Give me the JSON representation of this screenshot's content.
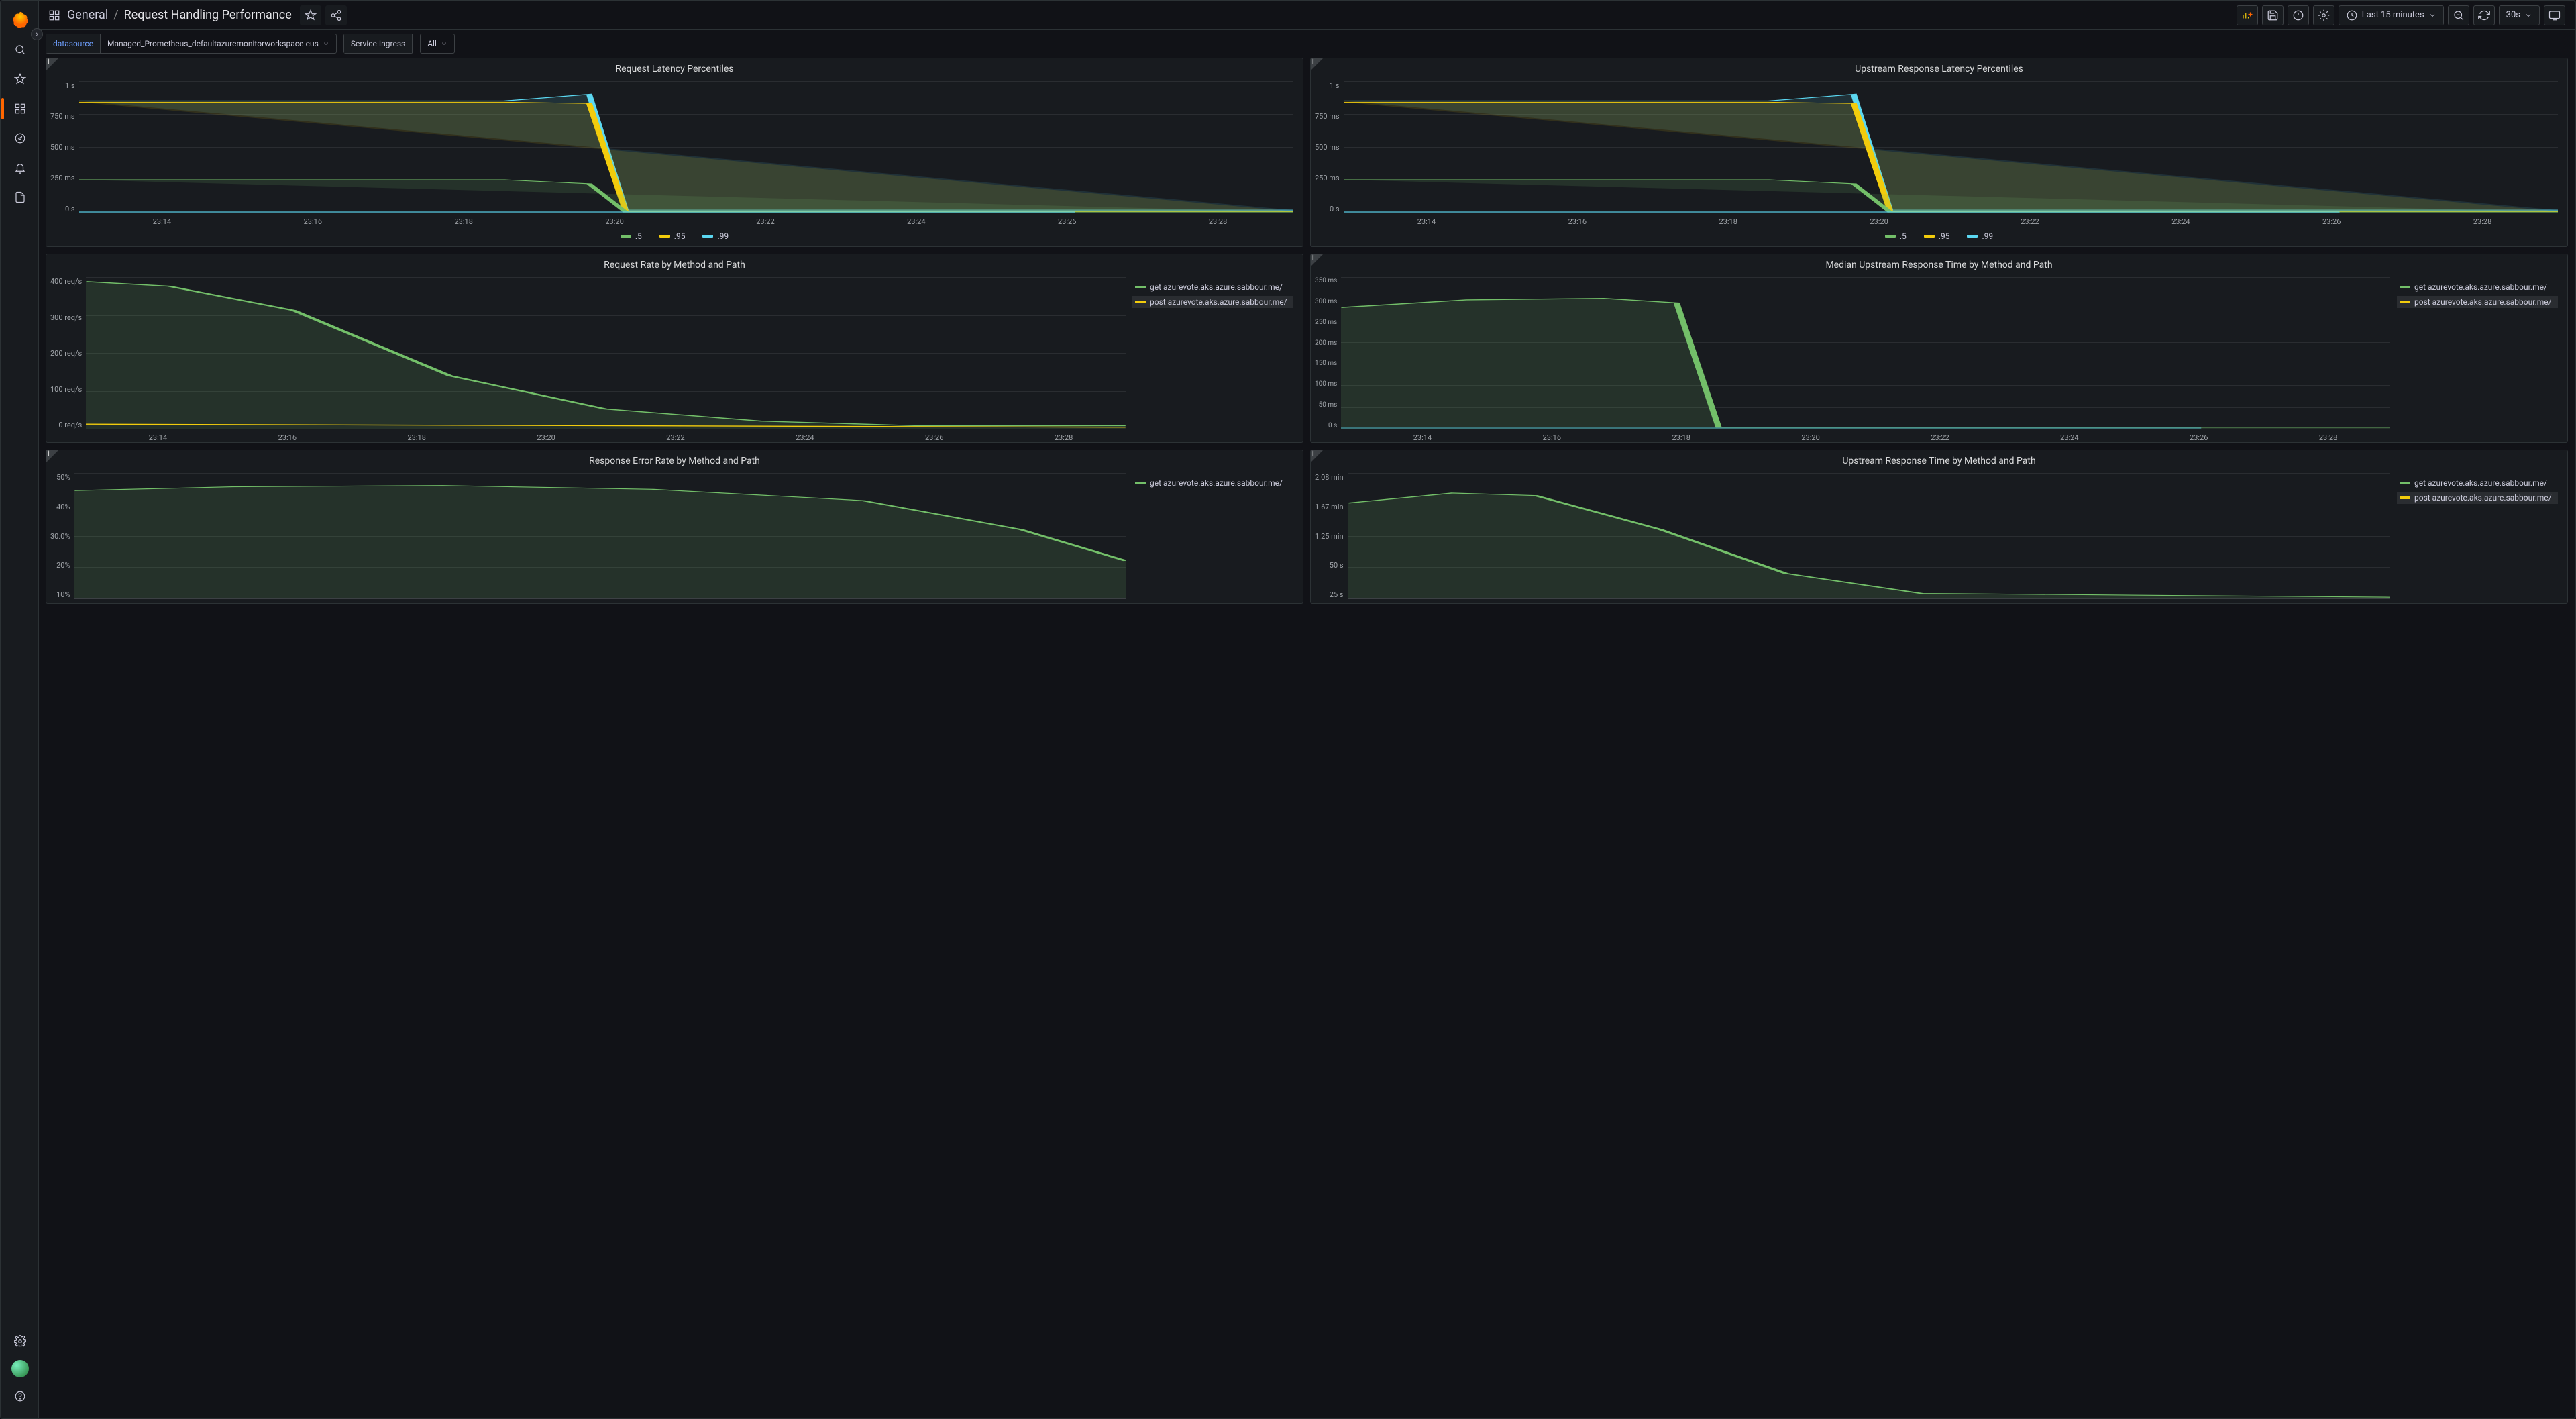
{
  "breadcrumb": {
    "folder": "General",
    "sep": "/",
    "title": "Request Handling Performance"
  },
  "toolbar": {
    "time_range": "Last 15 minutes",
    "refresh_interval": "30s"
  },
  "vars": {
    "datasource_label": "datasource",
    "datasource_value": "Managed_Prometheus_defaultazuremonitorworkspace-eus",
    "ingress_label": "Service Ingress",
    "ingress_value": "All"
  },
  "xticks": [
    "23:14",
    "23:16",
    "23:18",
    "23:20",
    "23:22",
    "23:24",
    "23:26",
    "23:28"
  ],
  "legend_percentile": [
    {
      "label": ".5",
      "cls": "sw-green"
    },
    {
      "label": ".95",
      "cls": "sw-yellow"
    },
    {
      "label": ".99",
      "cls": "sw-blue"
    }
  ],
  "legend_methods": [
    {
      "label": "get azurevote.aks.azure.sabbour.me/",
      "cls": "sw-green"
    },
    {
      "label": "post azurevote.aks.azure.sabbour.me/",
      "cls": "sw-yellow"
    }
  ],
  "legend_get_only": [
    {
      "label": "get azurevote.aks.azure.sabbour.me/",
      "cls": "sw-green"
    }
  ],
  "panels": {
    "p1": {
      "title": "Request Latency Percentiles",
      "yticks": [
        "1 s",
        "750 ms",
        "500 ms",
        "250 ms",
        "0 s"
      ]
    },
    "p2": {
      "title": "Upstream Response Latency Percentiles",
      "yticks": [
        "1 s",
        "750 ms",
        "500 ms",
        "250 ms",
        "0 s"
      ]
    },
    "p3": {
      "title": "Request Rate by Method and Path",
      "yticks": [
        "400 req/s",
        "300 req/s",
        "200 req/s",
        "100 req/s",
        "0 req/s"
      ]
    },
    "p4": {
      "title": "Median Upstream Response Time by Method and Path",
      "yticks": [
        "350 ms",
        "300 ms",
        "250 ms",
        "200 ms",
        "150 ms",
        "100 ms",
        "50 ms",
        "0 s"
      ]
    },
    "p5": {
      "title": "Response Error Rate by Method and Path",
      "yticks": [
        "50%",
        "40%",
        "30.0%",
        "20%",
        "10%"
      ]
    },
    "p6": {
      "title": "Upstream Response Time by Method and Path",
      "yticks": [
        "2.08 min",
        "1.67 min",
        "1.25 min",
        "50 s",
        "25 s"
      ]
    }
  },
  "chart_data": [
    {
      "id": "p1",
      "type": "line",
      "title": "Request Latency Percentiles",
      "x": [
        "23:14",
        "23:16",
        "23:18",
        "23:20",
        "23:22",
        "23:24",
        "23:26",
        "23:28"
      ],
      "ylabel": "",
      "ylim": [
        0,
        1000
      ],
      "y_unit": "ms",
      "series": [
        {
          "name": ".5",
          "values": [
            250,
            250,
            250,
            230,
            5,
            5,
            5,
            5
          ]
        },
        {
          "name": ".95",
          "values": [
            850,
            850,
            850,
            840,
            10,
            10,
            10,
            10
          ]
        },
        {
          "name": ".99",
          "values": [
            870,
            870,
            870,
            900,
            15,
            15,
            15,
            15
          ]
        }
      ]
    },
    {
      "id": "p2",
      "type": "line",
      "title": "Upstream Response Latency Percentiles",
      "x": [
        "23:14",
        "23:16",
        "23:18",
        "23:20",
        "23:22",
        "23:24",
        "23:26",
        "23:28"
      ],
      "ylabel": "",
      "ylim": [
        0,
        1000
      ],
      "y_unit": "ms",
      "series": [
        {
          "name": ".5",
          "values": [
            250,
            250,
            250,
            230,
            5,
            5,
            5,
            5
          ]
        },
        {
          "name": ".95",
          "values": [
            850,
            850,
            850,
            840,
            10,
            10,
            10,
            10
          ]
        },
        {
          "name": ".99",
          "values": [
            870,
            870,
            870,
            900,
            15,
            15,
            15,
            15
          ]
        }
      ]
    },
    {
      "id": "p3",
      "type": "line",
      "title": "Request Rate by Method and Path",
      "x": [
        "23:14",
        "23:16",
        "23:18",
        "23:20",
        "23:22",
        "23:24",
        "23:26",
        "23:28"
      ],
      "ylabel": "req/s",
      "ylim": [
        0,
        400
      ],
      "series": [
        {
          "name": "get azurevote.aks.azure.sabbour.me/",
          "values": [
            390,
            380,
            310,
            140,
            50,
            20,
            5,
            5
          ]
        },
        {
          "name": "post azurevote.aks.azure.sabbour.me/",
          "values": [
            10,
            10,
            8,
            5,
            3,
            2,
            1,
            1
          ]
        }
      ]
    },
    {
      "id": "p4",
      "type": "line",
      "title": "Median Upstream Response Time by Method and Path",
      "x": [
        "23:14",
        "23:16",
        "23:18",
        "23:20",
        "23:22",
        "23:24",
        "23:26",
        "23:28"
      ],
      "ylabel": "ms",
      "ylim": [
        0,
        350
      ],
      "series": [
        {
          "name": "get azurevote.aks.azure.sabbour.me/",
          "values": [
            280,
            295,
            300,
            290,
            3,
            3,
            3,
            3
          ]
        },
        {
          "name": "post azurevote.aks.azure.sabbour.me/",
          "values": [
            280,
            295,
            300,
            290,
            3,
            3,
            3,
            3
          ]
        }
      ]
    },
    {
      "id": "p5",
      "type": "line",
      "title": "Response Error Rate by Method and Path",
      "x": [
        "23:14",
        "23:16",
        "23:18",
        "23:20",
        "23:22",
        "23:24",
        "23:26",
        "23:28"
      ],
      "ylabel": "%",
      "ylim": [
        0,
        50
      ],
      "series": [
        {
          "name": "get azurevote.aks.azure.sabbour.me/",
          "values": [
            44,
            45,
            46,
            45,
            43,
            38,
            28,
            12
          ]
        }
      ]
    },
    {
      "id": "p6",
      "type": "line",
      "title": "Upstream Response Time by Method and Path",
      "x": [
        "23:14",
        "23:16",
        "23:18",
        "23:20",
        "23:22",
        "23:24",
        "23:26",
        "23:28"
      ],
      "ylabel": "",
      "ylim": [
        0,
        125
      ],
      "y_unit": "s",
      "series": [
        {
          "name": "get azurevote.aks.azure.sabbour.me/",
          "values": [
            95,
            105,
            102,
            70,
            25,
            5,
            2,
            2
          ]
        },
        {
          "name": "post azurevote.aks.azure.sabbour.me/",
          "values": [
            95,
            105,
            102,
            70,
            25,
            5,
            2,
            2
          ]
        }
      ]
    }
  ]
}
